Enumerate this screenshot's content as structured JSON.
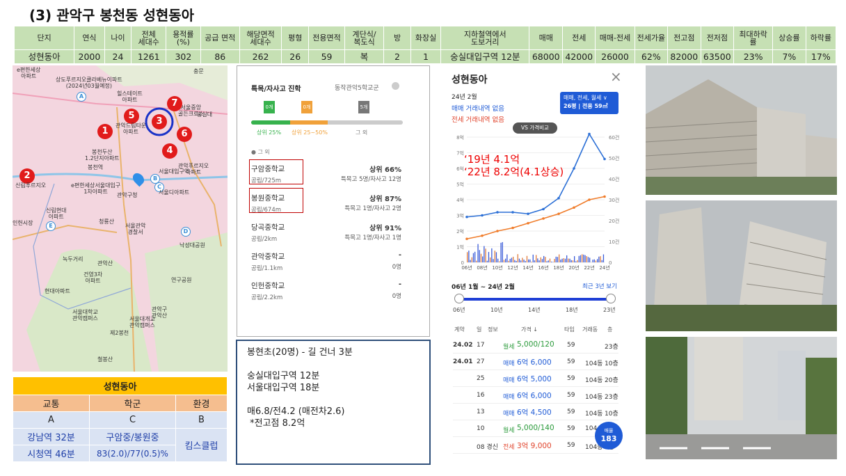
{
  "title": "(3) 관악구 봉천동 성현동아",
  "info_table": {
    "headers": [
      "단지",
      "연식",
      "나이",
      "전체\n세대수",
      "용적률\n(%)",
      "공급 면적",
      "해당면적\n세대수",
      "평형",
      "전용면적",
      "계단식/\n복도식",
      "방",
      "화장실",
      "지하철역에서\n도보거리",
      "매매",
      "전세",
      "매매-전세",
      "전세가율",
      "전고점",
      "전저점",
      "최대하락\n률",
      "상승률",
      "하락률"
    ],
    "values": [
      "성현동아",
      "2000",
      "24",
      "1261",
      "302",
      "86",
      "262",
      "26",
      "59",
      "복",
      "2",
      "1",
      "숭실대입구역  12분",
      "68000",
      "42000",
      "26000",
      "62%",
      "82000",
      "63500",
      "23%",
      "7%",
      "17%"
    ]
  },
  "map": {
    "pins": [
      "1",
      "2",
      "3",
      "4",
      "5",
      "6",
      "7"
    ],
    "markers": [
      "A",
      "B",
      "C",
      "D",
      "E"
    ],
    "labels": [
      "e편한세상\n아파트",
      "상도푸르지오클라베뉴이파트\n(2024년03월예정)",
      "힐스테이트\n아파트",
      "충문",
      "관악드림타운\n아파트",
      "서울중앙\n골든크로스",
      "숭실대",
      "봉천두산\n1.2단지아파트",
      "관악푸르지오\n아파트",
      "봉천역",
      "서울대입구역",
      "신림푸르지오",
      "e편한세상서울대입구\n1차아파트",
      "관악구청",
      "서울디아파트",
      "신림현대\n아파트",
      "청룡산",
      "서울관악\n경찰서",
      "인헌시장",
      "낙성대공원",
      "녹두거리",
      "관악산",
      "건영3차\n아파트",
      "현대아파트",
      "연구공원",
      "서울대학교\n관악캠퍼스",
      "관악구\n관악산",
      "서울대개교\n관악캠퍼스",
      "제2봉천",
      "철봉산"
    ]
  },
  "summary": {
    "name": "성현동아",
    "headers": [
      "교통",
      "학군",
      "환경"
    ],
    "row1": [
      "A",
      "C",
      "B"
    ],
    "row2": [
      "강남역 32분",
      "구암중/봉원중",
      "킴스클럽"
    ],
    "row3": [
      "시청역 46분",
      "83(2.0)/77(0.5)%"
    ]
  },
  "school": {
    "tab_left": "특목/자사고 진학",
    "tab_right": "동작관악5학교군",
    "flags": [
      "0개",
      "0개",
      "5개"
    ],
    "flag_labels": [
      "상위 25%",
      "상위 25~50%",
      "그 외"
    ],
    "legend": "그 외",
    "rows": [
      {
        "name": "구암중학교",
        "sub": "공립/725m",
        "rank": "상위 66%",
        "detail": "특목고 5명/자사고 12명"
      },
      {
        "name": "봉원중학교",
        "sub": "공립/674m",
        "rank": "상위 87%",
        "detail": "특목고 1명/자사고 2명"
      },
      {
        "name": "당곡중학교",
        "sub": "공립/2km",
        "rank": "상위 91%",
        "detail": "특목고 1명/자사고 1명"
      },
      {
        "name": "관악중학교",
        "sub": "공립/1.1km",
        "rank": "-",
        "detail": "0명"
      },
      {
        "name": "인헌중학교",
        "sub": "공립/2.2km",
        "rank": "-",
        "detail": "0명"
      }
    ]
  },
  "notes": [
    "봉현초(20명) - 길 건너 3분",
    "",
    "숭실대입구역 12분",
    "서울대입구역 18분",
    "",
    "매6.8/전4.2 (매전차2.6)",
    " *전고점 8.2억"
  ],
  "deal": {
    "title": "성현동아",
    "date": "24년 2월",
    "line1": "매매 거래내역 없음",
    "line2": "전세 거래내역 없음",
    "badge_line1": "매매, 전세, 월세 ∨",
    "badge_line2": "26평 | 전용 59㎡",
    "compare_btn": "VS 가격비교",
    "annot1": "‘19년 4.1억",
    "annot2": "‘22년 8.2억(4.1상승)",
    "y_left": [
      "8억",
      "7억",
      "6억",
      "5억",
      "4억",
      "3억",
      "2억",
      "1억",
      "0"
    ],
    "y_right": [
      "60건",
      "50건",
      "40건",
      "30건",
      "20건",
      "10건",
      "0"
    ],
    "x_ticks": [
      "06년",
      "08년",
      "10년",
      "12년",
      "14년",
      "16년",
      "18년",
      "20년",
      "22년",
      "24년"
    ],
    "range_text": "06년 1월 ~ 24년 2월",
    "recent": "최근 3년 보기",
    "slider_ticks": [
      "06년",
      "10년",
      "14년",
      "18년",
      "23년"
    ],
    "cols": [
      "계약",
      "일",
      "정보",
      "가격 ↓",
      "타입",
      "거래동",
      "층"
    ],
    "rows": [
      {
        "ym": "24.02",
        "d": "17",
        "type": "월세",
        "price": "5,000/120",
        "area": "59",
        "dong": "",
        "fl": "23층"
      },
      {
        "ym": "24.01",
        "d": "27",
        "type": "매매",
        "price": "6억 6,000",
        "area": "59",
        "dong": "104동",
        "fl": "10층"
      },
      {
        "ym": "",
        "d": "25",
        "type": "매매",
        "price": "6억 5,000",
        "area": "59",
        "dong": "104동",
        "fl": "20층"
      },
      {
        "ym": "",
        "d": "16",
        "type": "매매",
        "price": "6억 6,000",
        "area": "59",
        "dong": "104동",
        "fl": "23층"
      },
      {
        "ym": "",
        "d": "13",
        "type": "매매",
        "price": "6억 4,500",
        "area": "59",
        "dong": "104동",
        "fl": "10층"
      },
      {
        "ym": "",
        "d": "10",
        "type": "월세",
        "price": "5,000/140",
        "area": "59",
        "dong": "104",
        "fl": ""
      },
      {
        "ym": "",
        "d": "08 경신",
        "type": "전세",
        "price": "3억 9,000",
        "area": "59",
        "dong": "104동",
        "fl": "7층"
      }
    ],
    "fab_label": "매물",
    "fab_count": "183"
  },
  "chart_data": {
    "type": "line",
    "x": [
      "06년",
      "08년",
      "10년",
      "12년",
      "14년",
      "16년",
      "18년",
      "20년",
      "22년",
      "24년"
    ],
    "series": [
      {
        "name": "매매",
        "values": [
          2.9,
          3.0,
          3.2,
          3.2,
          3.1,
          3.4,
          4.1,
          6.0,
          8.2,
          6.6
        ]
      },
      {
        "name": "전세",
        "values": [
          1.5,
          1.7,
          2.0,
          2.2,
          2.5,
          2.8,
          3.1,
          3.5,
          4.0,
          4.2
        ]
      }
    ],
    "ylim": [
      0,
      8
    ]
  }
}
